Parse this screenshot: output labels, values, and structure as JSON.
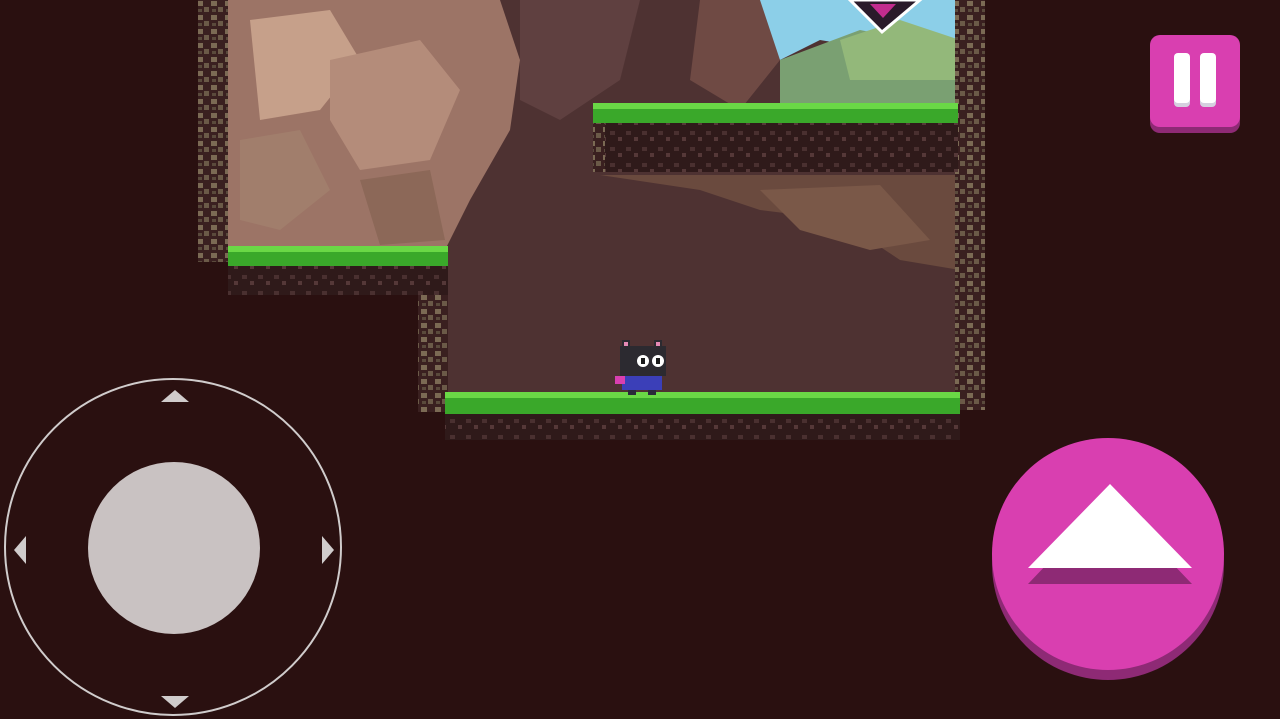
{
  "game": {
    "colors": {
      "background": "#2a1010",
      "cave_wall": "#4e3232",
      "grass": "#3aa82a",
      "grass_light": "#6ad846",
      "dirt": "#3a2020",
      "rock": "#8a7a60",
      "sky": "#8ccfe8",
      "accent": "#d93fb0",
      "accent_dark": "#8e2a75"
    },
    "player": {
      "icon": "black-cat-character"
    },
    "enemy": {
      "icon": "bat-enemy"
    }
  },
  "controls": {
    "pause_icon": "pause-icon",
    "jump_icon": "up-triangle-icon",
    "joystick_icons": [
      "arrow-up-icon",
      "arrow-down-icon",
      "arrow-left-icon",
      "arrow-right-icon"
    ]
  }
}
